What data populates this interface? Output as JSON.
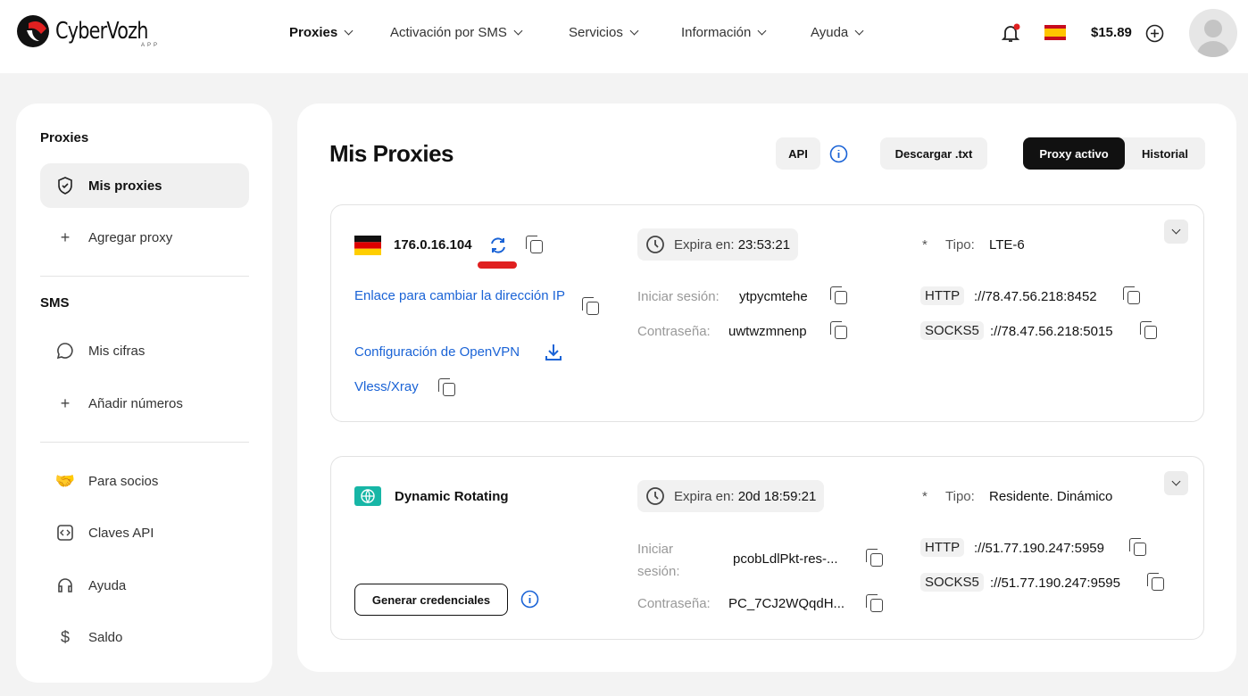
{
  "header": {
    "logo": "CyberVozh",
    "logo_sub": "APP",
    "nav": [
      {
        "label": "Proxies"
      },
      {
        "label": "Activación por SMS"
      },
      {
        "label": "Servicios"
      },
      {
        "label": "Información"
      },
      {
        "label": "Ayuda"
      }
    ],
    "balance": "$15.89"
  },
  "sidebar": {
    "sections": [
      {
        "title": "Proxies"
      },
      {
        "title": "SMS"
      }
    ],
    "items": [
      {
        "label": "Mis proxies",
        "icon": "shield-icon"
      },
      {
        "label": "Agregar proxy",
        "icon": "plus-icon"
      },
      {
        "label": "Mis cifras",
        "icon": "chat-icon"
      },
      {
        "label": "Añadir números",
        "icon": "plus-icon"
      },
      {
        "label": "Para socios",
        "icon": "handshake-icon"
      },
      {
        "label": "Claves API",
        "icon": "code-icon"
      },
      {
        "label": "Ayuda",
        "icon": "headset-icon"
      },
      {
        "label": "Saldo",
        "icon": "dollar-icon"
      }
    ]
  },
  "main": {
    "title": "Mis Proxies",
    "api_label": "API",
    "download_label": "Descargar .txt",
    "tabs": [
      {
        "label": "Proxy activo"
      },
      {
        "label": "Historial"
      }
    ]
  },
  "proxies": [
    {
      "name": "176.0.16.104",
      "expire_label": "Expira en:",
      "expire": "23:53:21",
      "type_label": "Tipo:",
      "type": "LTE-6",
      "links": [
        "Enlace para cambiar la dirección IP",
        "Configuración de OpenVPN",
        "Vless/Xray"
      ],
      "login_label": "Iniciar sesión:",
      "login": "ytpycmtehe",
      "password_label": "Contraseña:",
      "password": "uwtwzmnenp",
      "http_label": "HTTP",
      "http": "://78.47.56.218:8452",
      "socks_label": "SOCKS5",
      "socks": "://78.47.56.218:5015"
    },
    {
      "name": "Dynamic Rotating",
      "expire_label": "Expira en:",
      "expire": "20d 18:59:21",
      "type_label": "Tipo:",
      "type": "Residente. Dinámico",
      "generate_label": "Generar credenciales",
      "login_label": "Iniciar sesión:",
      "login": "pcobLdlPkt-res-...",
      "password_label": "Contraseña:",
      "password": "PC_7CJ2WQqdH...",
      "http_label": "HTTP",
      "http": "://51.77.190.247:5959",
      "socks_label": "SOCKS5",
      "socks": "://51.77.190.247:9595"
    }
  ],
  "colors": {
    "accent": "#1a63d6",
    "dark": "#111111",
    "red": "#e02020"
  }
}
